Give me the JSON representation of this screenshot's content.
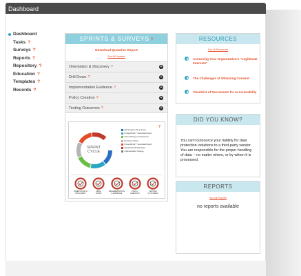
{
  "window": {
    "title": "Dashboard"
  },
  "nav": {
    "items": [
      {
        "label": "Dashboard",
        "has_help": false,
        "active": true
      },
      {
        "label": "Tasks",
        "has_help": true
      },
      {
        "label": "Surveys",
        "has_help": true
      },
      {
        "label": "Reports",
        "has_help": true
      },
      {
        "label": "Repository",
        "has_help": true
      },
      {
        "label": "Education",
        "has_help": true
      },
      {
        "label": "Templates",
        "has_help": true
      },
      {
        "label": "Records",
        "has_help": true
      }
    ],
    "help_glyph": "?"
  },
  "sprints": {
    "title": "SPRINTS & SURVEYS",
    "help_glyph": "?",
    "download_label": "Download Question Report",
    "see_all_label": "See All Updates",
    "accordion": [
      {
        "label": "Orientation & Discovery",
        "help": "?"
      },
      {
        "label": "Drill Down",
        "help": "?"
      },
      {
        "label": "Implementation Evidence",
        "help": "?"
      },
      {
        "label": "Policy Creation",
        "help": "?"
      },
      {
        "label": "Testing Outcomes",
        "help": "?"
      }
    ],
    "cycle": {
      "help_glyph": "?",
      "center_line1": "SPRINT",
      "center_line2": "CYCLE",
      "legend": [
        {
          "label": "Sprint begins with a Survey",
          "color": "#2a6fbf"
        },
        {
          "label": "PrivacyWorks™ Generated Report",
          "color": "#2aa6c4"
        },
        {
          "label": "Team Meeting or Assessments",
          "color": "#6abd45"
        },
        {
          "label": "Document Library",
          "color": "#b5b5b5"
        },
        {
          "label": "PrivacyWorks™ Generated Report",
          "color": "#e34c26"
        },
        {
          "label": "Sprint Ends Monthly Steps",
          "color": "#c0392b"
        },
        {
          "label": "Implementation Strategy",
          "color": "#7a7a7a"
        }
      ],
      "steps": [
        {
          "label_line1": "ORIENTATION &",
          "label_line2": "DISCOVERY"
        },
        {
          "label_line1": "DRILL",
          "label_line2": "DOWN"
        },
        {
          "label_line1": "IMPLEMENTATION",
          "label_line2": "& EVIDENCE"
        },
        {
          "label_line1": "POLICY",
          "label_line2": "CREATION"
        },
        {
          "label_line1": "TESTING",
          "label_line2": "OUTCOMES"
        }
      ]
    }
  },
  "resources": {
    "title": "RESOURCES",
    "see_all_label": "See All Resources",
    "items": [
      {
        "line1": "Assessing Your Organization's \"Legitimate",
        "line2": "Interests\""
      },
      {
        "line1": "The Challenges of Obtaining Consent",
        "line2": ""
      },
      {
        "line1": "Checklist of Documents for Accountability",
        "line2": ""
      }
    ]
  },
  "did_you_know": {
    "title": "DID YOU KNOW?",
    "text": "You can't outsource your liability for data protection violations to a third-party vendor.  You are responsible for the proper handling of data -- no matter where, or by whom it is processed."
  },
  "reports": {
    "title": "REPORTS",
    "see_all_label": "See All Reports",
    "empty_label": "no reports available"
  },
  "colors": {
    "accent_teal": "#2aa6c4",
    "header_teal": "#c9e7ee",
    "link_orange": "#e34c26",
    "titlebar_dark": "#4a4a4a"
  }
}
